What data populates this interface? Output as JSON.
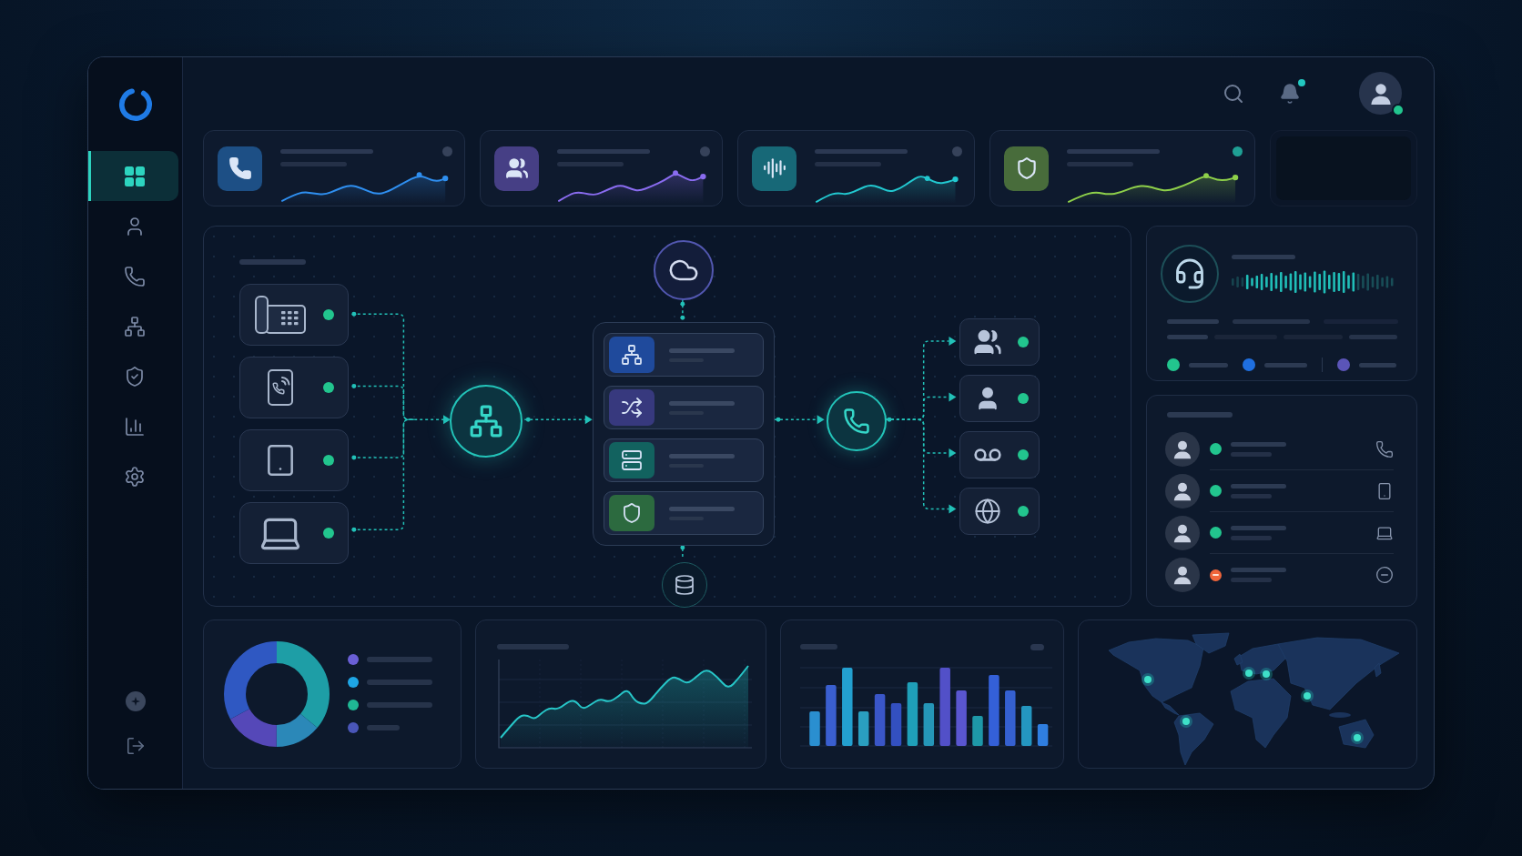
{
  "sidebar": {
    "items": [
      {
        "selected": true
      },
      {
        "selected": false
      },
      {
        "selected": false
      },
      {
        "selected": false
      },
      {
        "selected": false
      },
      {
        "selected": false
      },
      {
        "selected": false
      }
    ]
  },
  "top_bar": {
    "notifications": {
      "unread": true
    },
    "user": {
      "online": true
    }
  },
  "stat_cards": [
    {
      "color": "#2f8ff0",
      "active": false
    },
    {
      "color": "#8a6cf0",
      "active": false
    },
    {
      "color": "#22c8d0",
      "active": false
    },
    {
      "color": "#8ed04a",
      "active": true
    }
  ],
  "flow": {
    "sources": [
      {
        "online": true
      },
      {
        "online": true
      },
      {
        "online": true
      },
      {
        "online": true
      }
    ],
    "routing_steps": [
      {
        "color": "#1f4a9c"
      },
      {
        "color": "#37397e"
      },
      {
        "color": "#12625f"
      },
      {
        "color": "#2c6a3f"
      }
    ],
    "destinations": [
      {
        "online": true
      },
      {
        "online": true
      },
      {
        "online": true
      },
      {
        "online": true
      }
    ]
  },
  "agent_monitor": {
    "legend": [
      {
        "color": "#22c58e"
      },
      {
        "color": "#1f6fe0"
      },
      {
        "color": "#5b55b8"
      }
    ]
  },
  "agents": [
    {
      "color": "#22c58e",
      "busy": false
    },
    {
      "color": "#22c58e",
      "busy": false
    },
    {
      "color": "#22c58e",
      "busy": false
    },
    {
      "color": "#f0653a",
      "busy": true
    }
  ],
  "donut_chart": {
    "legend": [
      {
        "color": "#6a5fd6"
      },
      {
        "color": "#1ea6e6"
      },
      {
        "color": "#1fb894"
      },
      {
        "color": "#4a56b8"
      }
    ]
  }
}
